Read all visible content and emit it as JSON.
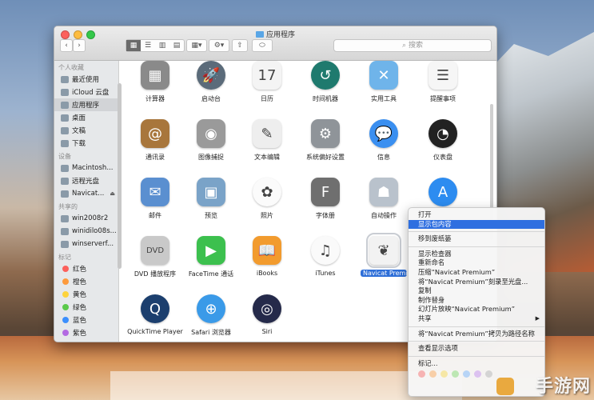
{
  "window": {
    "title": "应用程序"
  },
  "toolbar": {
    "back": "‹",
    "forward": "›",
    "search_placeholder": "搜索"
  },
  "sidebar": {
    "favorites_head": "个人收藏",
    "favorites": [
      {
        "label": "最近使用",
        "icon": "recent-icon"
      },
      {
        "label": "iCloud 云盘",
        "icon": "cloud-icon"
      },
      {
        "label": "应用程序",
        "icon": "applications-icon",
        "selected": true
      },
      {
        "label": "桌面",
        "icon": "desktop-icon"
      },
      {
        "label": "文稿",
        "icon": "document-icon"
      },
      {
        "label": "下载",
        "icon": "download-icon"
      }
    ],
    "devices_head": "设备",
    "devices": [
      {
        "label": "Macintosh...",
        "icon": "disk-icon"
      },
      {
        "label": "远程光盘",
        "icon": "remote-disc-icon"
      },
      {
        "label": "Navicat...",
        "icon": "disk-image-icon",
        "eject": "⏏"
      }
    ],
    "shared_head": "共享的",
    "shared": [
      {
        "label": "win2008r2",
        "icon": "computer-icon"
      },
      {
        "label": "winidilo08s...",
        "icon": "computer-icon"
      },
      {
        "label": "winserverf...",
        "icon": "computer-icon"
      }
    ],
    "tags_head": "标记",
    "tags": [
      {
        "label": "红色",
        "color": "#fc605c"
      },
      {
        "label": "橙色",
        "color": "#fd9a3c"
      },
      {
        "label": "黄色",
        "color": "#fdd33c"
      },
      {
        "label": "绿色",
        "color": "#5bc94a"
      },
      {
        "label": "蓝色",
        "color": "#3c8ffd"
      },
      {
        "label": "紫色",
        "color": "#b36ae2"
      }
    ]
  },
  "apps": [
    {
      "label": "计算器",
      "icon": "calculator-icon",
      "color": "#8a8a8a",
      "glyph": "▦"
    },
    {
      "label": "启动台",
      "icon": "launchpad-icon",
      "color": "#5b6b7a",
      "glyph": "🚀",
      "round": true
    },
    {
      "label": "日历",
      "icon": "calendar-icon",
      "color": "#f4f4f4",
      "glyph": "17",
      "dark": true
    },
    {
      "label": "时间机器",
      "icon": "time-machine-icon",
      "color": "#1f7a6e",
      "glyph": "↺",
      "round": true
    },
    {
      "label": "实用工具",
      "icon": "utilities-folder-icon",
      "color": "#6fb4ea",
      "glyph": "✕"
    },
    {
      "label": "提醒事项",
      "icon": "reminders-icon",
      "color": "#f6f6f6",
      "glyph": "☰",
      "dark": true
    },
    {
      "label": "通讯录",
      "icon": "contacts-icon",
      "color": "#a8763c",
      "glyph": "@"
    },
    {
      "label": "图像捕捉",
      "icon": "image-capture-icon",
      "color": "#9a9a9a",
      "glyph": "◉"
    },
    {
      "label": "文本编辑",
      "icon": "textedit-icon",
      "color": "#eeeeee",
      "glyph": "✎",
      "dark": true
    },
    {
      "label": "系统偏好设置",
      "icon": "system-preferences-icon",
      "color": "#8f9499",
      "glyph": "⚙"
    },
    {
      "label": "信息",
      "icon": "messages-icon",
      "color": "#3a8ff0",
      "glyph": "💬",
      "round": true
    },
    {
      "label": "仪表盘",
      "icon": "dashboard-icon",
      "color": "#222222",
      "glyph": "◔",
      "round": true
    },
    {
      "label": "邮件",
      "icon": "mail-icon",
      "color": "#5a8fd0",
      "glyph": "✉"
    },
    {
      "label": "预览",
      "icon": "preview-icon",
      "color": "#7aa3c8",
      "glyph": "▣"
    },
    {
      "label": "照片",
      "icon": "photos-icon",
      "color": "#fbfbfb",
      "glyph": "✿",
      "dark": true,
      "round": true
    },
    {
      "label": "字体册",
      "icon": "font-book-icon",
      "color": "#6f6f6f",
      "glyph": "F"
    },
    {
      "label": "自动操作",
      "icon": "automator-icon",
      "color": "#b9c2cc",
      "glyph": "☗"
    },
    {
      "label": "App Store",
      "icon": "app-store-icon",
      "color": "#2d8cf0",
      "glyph": "A",
      "round": true,
      "hidden_label": true
    },
    {
      "label": "DVD 播放程序",
      "icon": "dvd-player-icon",
      "color": "#c9c9c9",
      "glyph": "DVD",
      "dark": true
    },
    {
      "label": "FaceTime 通话",
      "icon": "facetime-icon",
      "color": "#3cc04e",
      "glyph": "▶"
    },
    {
      "label": "iBooks",
      "icon": "ibooks-icon",
      "color": "#f29b2e",
      "glyph": "📖"
    },
    {
      "label": "iTunes",
      "icon": "itunes-icon",
      "color": "#fafafa",
      "glyph": "♫",
      "dark": true,
      "round": true
    },
    {
      "label": "Navicat Premium",
      "icon": "navicat-icon",
      "color": "#f2f2f2",
      "glyph": "❦",
      "dark": true,
      "selected": true
    },
    {
      "label": "QuickTime Player",
      "icon": "quicktime-icon",
      "color": "#1c3f6e",
      "glyph": "Q",
      "round": true
    },
    {
      "label": "Safari 浏览器",
      "icon": "safari-icon",
      "color": "#3a9ae8",
      "glyph": "⊕",
      "round": true
    },
    {
      "label": "Siri",
      "icon": "siri-icon",
      "color": "#252a4a",
      "glyph": "◎",
      "round": true
    }
  ],
  "context_menu": {
    "groups": [
      [
        {
          "label": "打开"
        },
        {
          "label": "显示包内容",
          "highlighted": true
        }
      ],
      [
        {
          "label": "移到废纸篓"
        }
      ],
      [
        {
          "label": "显示检查器"
        },
        {
          "label": "重新命名"
        },
        {
          "label": "压缩“Navicat Premium”"
        },
        {
          "label": "将“Navicat Premium”刻录至光盘..."
        },
        {
          "label": "复制"
        },
        {
          "label": "制作替身"
        },
        {
          "label": "幻灯片放映“Navicat Premium”"
        },
        {
          "label": "共享",
          "submenu": "▶"
        }
      ],
      [
        {
          "label": "将“Navicat Premium”拷贝为路径名称"
        }
      ],
      [
        {
          "label": "查看显示选项"
        }
      ],
      [
        {
          "label": "标记..."
        }
      ]
    ],
    "tag_colors": [
      "#f6b3b3",
      "#f8cfa8",
      "#f6e7a6",
      "#bde7b4",
      "#b7d4f6",
      "#dcc2f0",
      "#d4d4d4"
    ]
  },
  "watermark": "手游网"
}
